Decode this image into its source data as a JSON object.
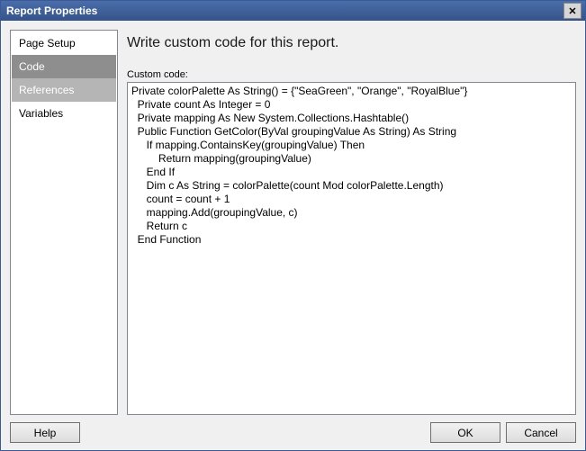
{
  "window": {
    "title": "Report Properties",
    "close_glyph": "✕"
  },
  "sidebar": {
    "items": [
      {
        "label": "Page Setup",
        "state": ""
      },
      {
        "label": "Code",
        "state": "sel"
      },
      {
        "label": "References",
        "state": "sec"
      },
      {
        "label": "Variables",
        "state": ""
      }
    ]
  },
  "main": {
    "heading": "Write custom code for this report.",
    "code_label": "Custom code:",
    "code": "Private colorPalette As String() = {\"SeaGreen\", \"Orange\", \"RoyalBlue\"}\n  Private count As Integer = 0\n  Private mapping As New System.Collections.Hashtable()\n  Public Function GetColor(ByVal groupingValue As String) As String\n     If mapping.ContainsKey(groupingValue) Then\n         Return mapping(groupingValue)\n     End If\n     Dim c As String = colorPalette(count Mod colorPalette.Length)\n     count = count + 1\n     mapping.Add(groupingValue, c)\n     Return c\n  End Function"
  },
  "buttons": {
    "help": "Help",
    "ok": "OK",
    "cancel": "Cancel"
  }
}
